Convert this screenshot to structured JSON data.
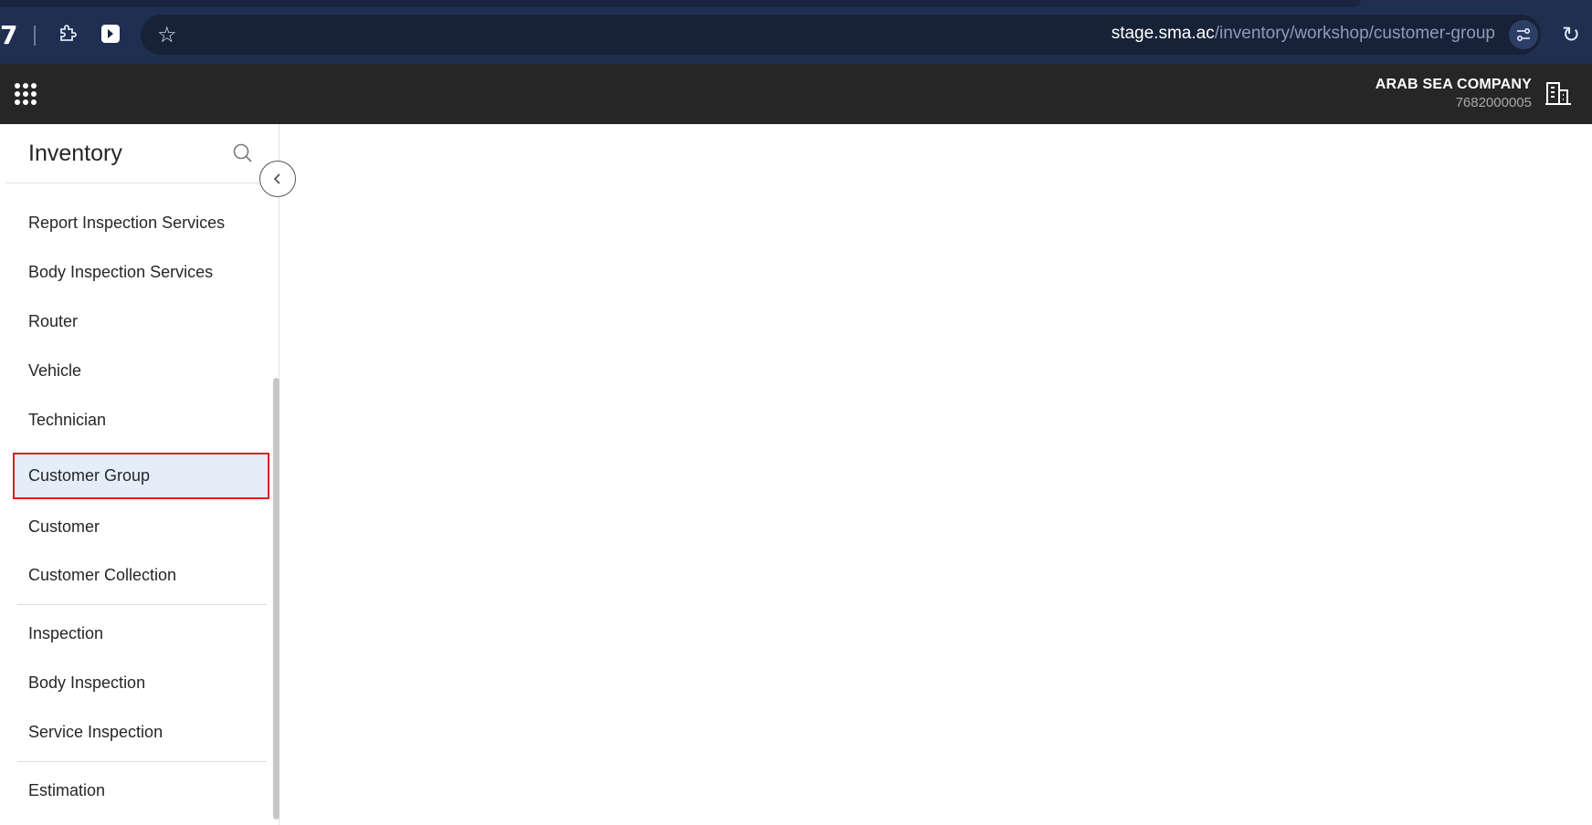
{
  "browser": {
    "url_host": "stage.sma.ac",
    "url_path": "/inventory/workshop/customer-group",
    "left_glyph": "7",
    "icons": [
      "extensions-icon",
      "extension-app-icon",
      "bookmark-star-icon",
      "site-settings-icon",
      "reload-icon"
    ]
  },
  "header": {
    "company_name": "ARAB SEA COMPANY",
    "company_id": "7682000005",
    "icons": [
      "apps-grid-icon",
      "building-icon"
    ]
  },
  "sidebar": {
    "title": "Inventory",
    "items": [
      {
        "label": "Report Inspection Services"
      },
      {
        "label": "Body Inspection Services"
      },
      {
        "label": "Router"
      },
      {
        "label": "Vehicle"
      },
      {
        "label": "Technician"
      },
      {
        "label": "Customer Group",
        "active": true
      },
      {
        "label": "Customer"
      },
      {
        "label": "Customer Collection"
      },
      {
        "label": "Inspection"
      },
      {
        "label": "Body Inspection"
      },
      {
        "label": "Service Inspection"
      },
      {
        "label": "Estimation"
      }
    ]
  },
  "colors": {
    "browser_bg": "#1f2f52",
    "app_header_bg": "#262626",
    "active_item_bg": "#e4eef8",
    "highlight_border": "#e31b23"
  }
}
